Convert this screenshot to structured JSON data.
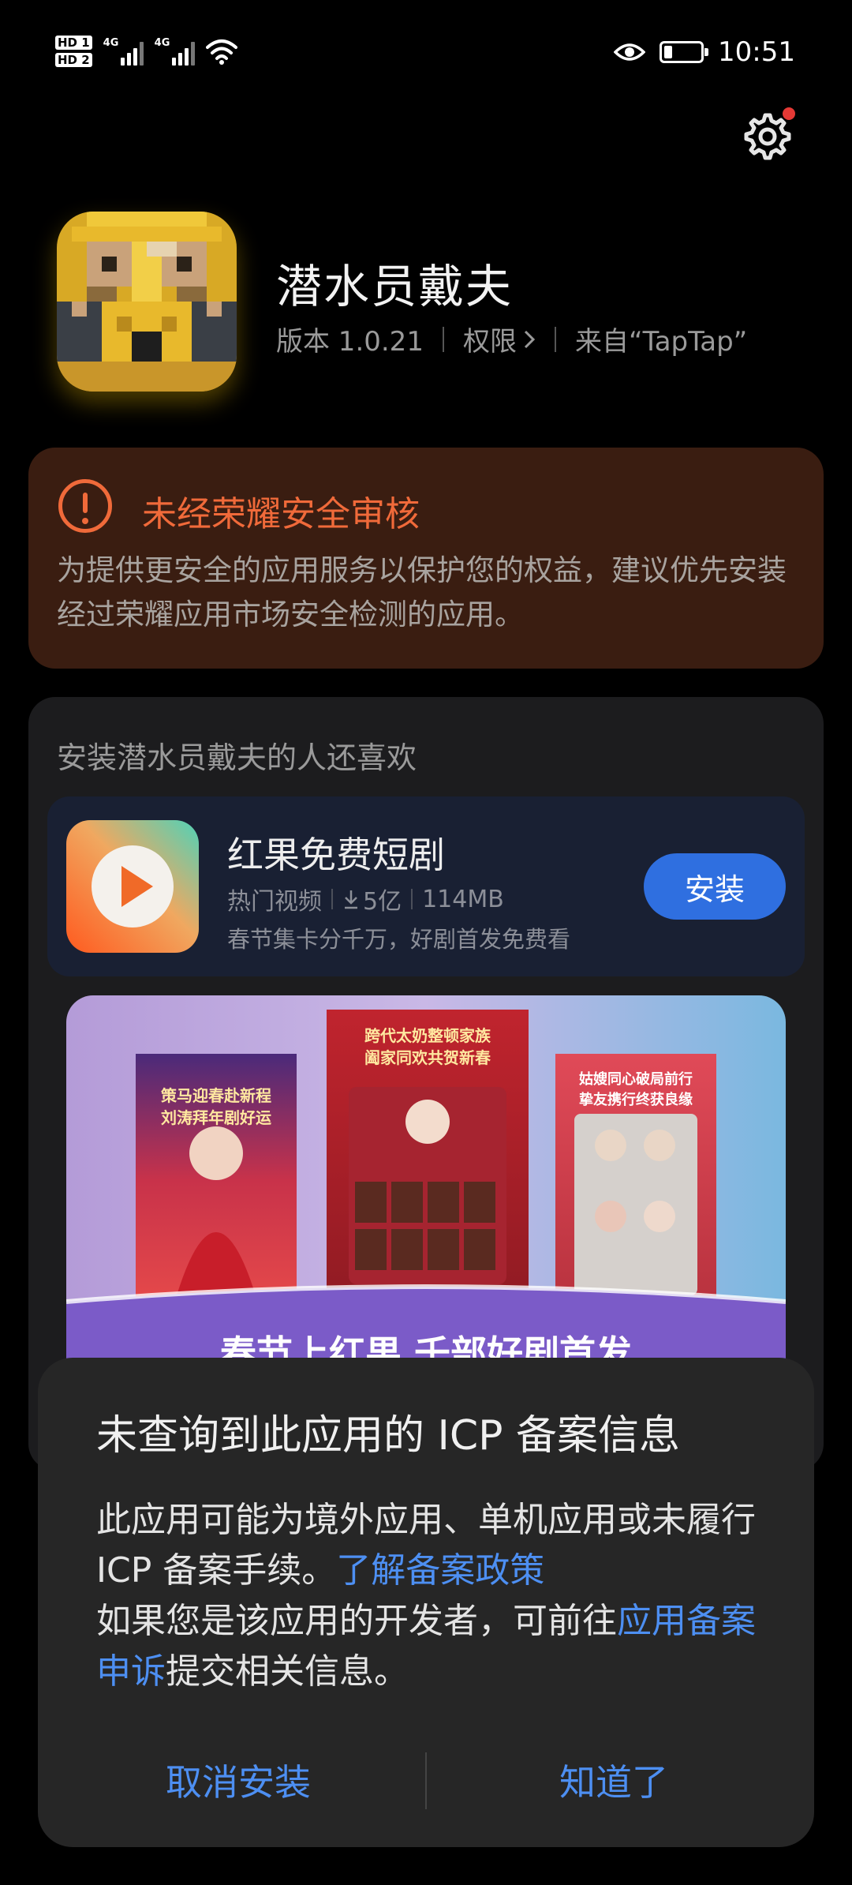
{
  "status_bar": {
    "hd1": "HD 1",
    "hd2": "HD 2",
    "net1": "4G",
    "net2": "4G",
    "time": "10:51"
  },
  "app": {
    "name": "潜水员戴夫",
    "version": "版本 1.0.21",
    "permissions": "权限",
    "source": "来自“TapTap”"
  },
  "warning": {
    "title": "未经荣耀安全审核",
    "body": "为提供更安全的应用服务以保护您的权益，建议优先安装经过荣耀应用市场安全检测的应用。"
  },
  "recommend": {
    "title": "安装潜水员戴夫的人还喜欢",
    "item": {
      "name": "红果免费短剧",
      "category": "热门视频",
      "downloads": "5亿",
      "size": "114MB",
      "desc": "春节集卡分千万，好剧首发免费看",
      "install_label": "安装"
    },
    "banner": {
      "poster1_line1": "策马迎春赴新程",
      "poster1_line2": "刘涛拜年剧好运",
      "poster2_line1": "跨代太奶整顿家族",
      "poster2_line2": "阖家同欢共贺新春",
      "poster3_line1": "姑嫂同心破局前行",
      "poster3_line2": "挚友携行终获良缘",
      "headline": "春节上红果 千部好剧首发"
    }
  },
  "dialog": {
    "title": "未查询到此应用的 ICP 备案信息",
    "body_part1": "此应用可能为境外应用、单机应用或未履行 ICP 备案手续。",
    "link1": "了解备案政策",
    "body_part2": "如果您是该应用的开发者，可前往",
    "link2": "应用备案申诉",
    "body_part3": "提交相关信息。",
    "cancel_label": "取消安装",
    "ok_label": "知道了"
  },
  "colors": {
    "accent_blue": "#4d8ff2",
    "warning_orange": "#f06a3a",
    "install_blue": "#2f6fe0"
  }
}
